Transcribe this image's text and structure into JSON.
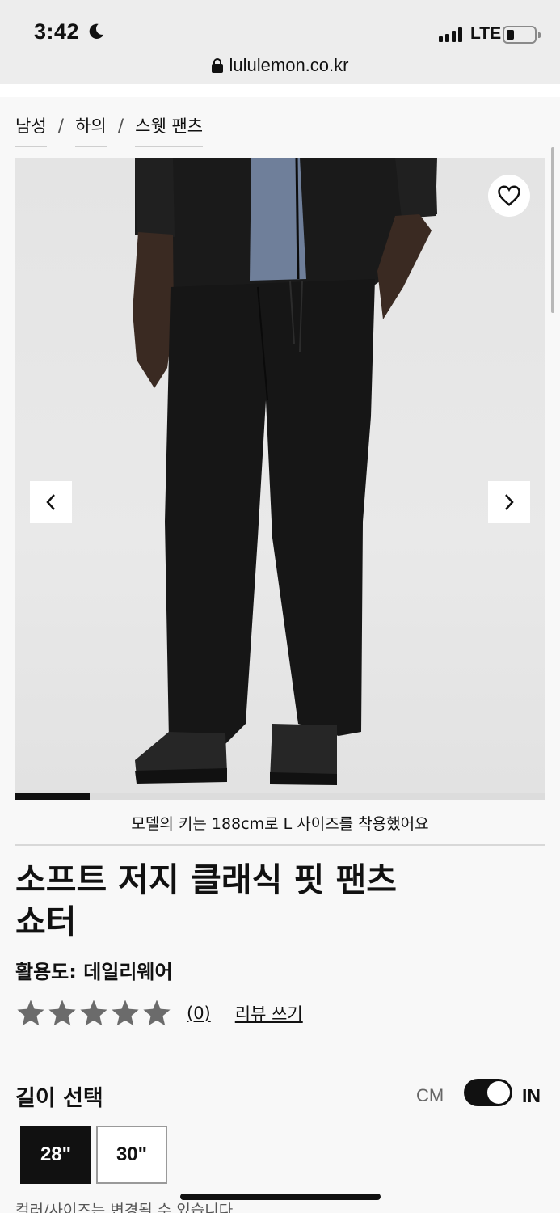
{
  "status_bar": {
    "time": "3:42",
    "network": "LTE",
    "battery_level": 0.25
  },
  "url_bar": {
    "domain": "lululemon.co.kr"
  },
  "breadcrumb": [
    "남성",
    "하의",
    "스웻 팬츠"
  ],
  "gallery": {
    "progress": 0.14,
    "model_note": "모델의 키는 188cm로 L 사이즈를 착용했어요"
  },
  "product": {
    "title_line1": "소프트 저지 클래식 핏 팬츠",
    "title_line2": "쇼터",
    "activity": "활용도: 데일리웨어",
    "rating_count": "(0)",
    "review_link": "리뷰 쓰기",
    "rating_stars": 5
  },
  "length": {
    "label": "길이 선택",
    "unit_cm": "CM",
    "unit_in": "IN",
    "unit_selected": "IN",
    "options": [
      "28\"",
      "30\""
    ],
    "selected": "28\""
  },
  "footnote": "컬러/사이즈는 변경될 수 있습니다",
  "colors": {
    "accent": "#111111",
    "star": "#6b6b6b",
    "background": "#f8f8f8"
  }
}
